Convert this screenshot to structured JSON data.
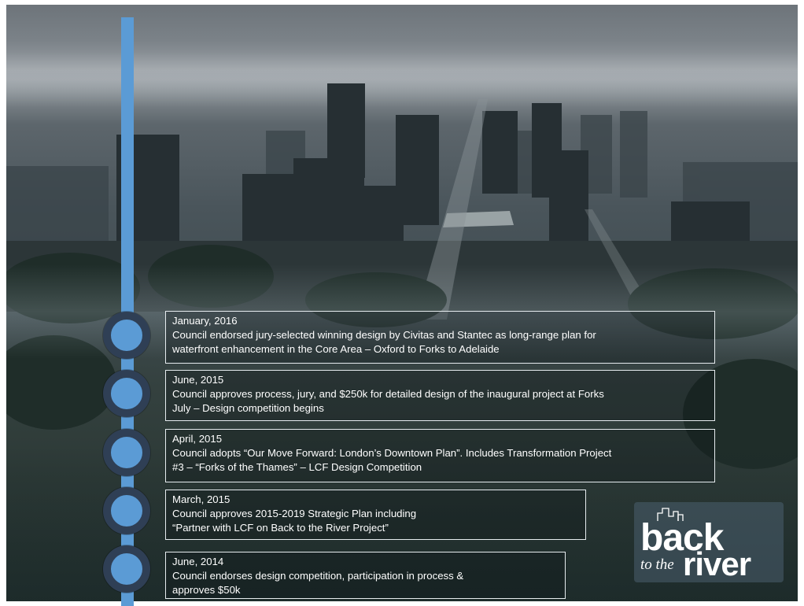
{
  "timeline": [
    {
      "date": "January, 2016",
      "description": "Council endorsed jury-selected winning design by Civitas and Stantec as long-range plan for\nwaterfront enhancement in the Core Area – Oxford to Forks to Adelaide"
    },
    {
      "date": "June, 2015",
      "description": "Council approves process, jury, and $250k for detailed design of the inaugural project at Forks\nJuly – Design competition begins"
    },
    {
      "date": "April, 2015",
      "description": "Council adopts “Our Move Forward: London’s Downtown Plan”.  Includes Transformation Project\n#3 – “Forks of the Thames” – LCF Design Competition"
    },
    {
      "date": "March, 2015",
      "description": "Council  approves 2015-2019 Strategic Plan including\n“Partner with LCF on Back to the River Project”"
    },
    {
      "date": "June, 2014",
      "description": "Council  endorses design competition, participation in process &\napproves $50k"
    }
  ],
  "logo": {
    "word_back": "back",
    "word_tothe": "to the",
    "word_river": "river"
  },
  "colors": {
    "timeline_blue": "#5b9bd5",
    "dot_ring": "#2f3f55",
    "box_border": "#e6ecef"
  }
}
